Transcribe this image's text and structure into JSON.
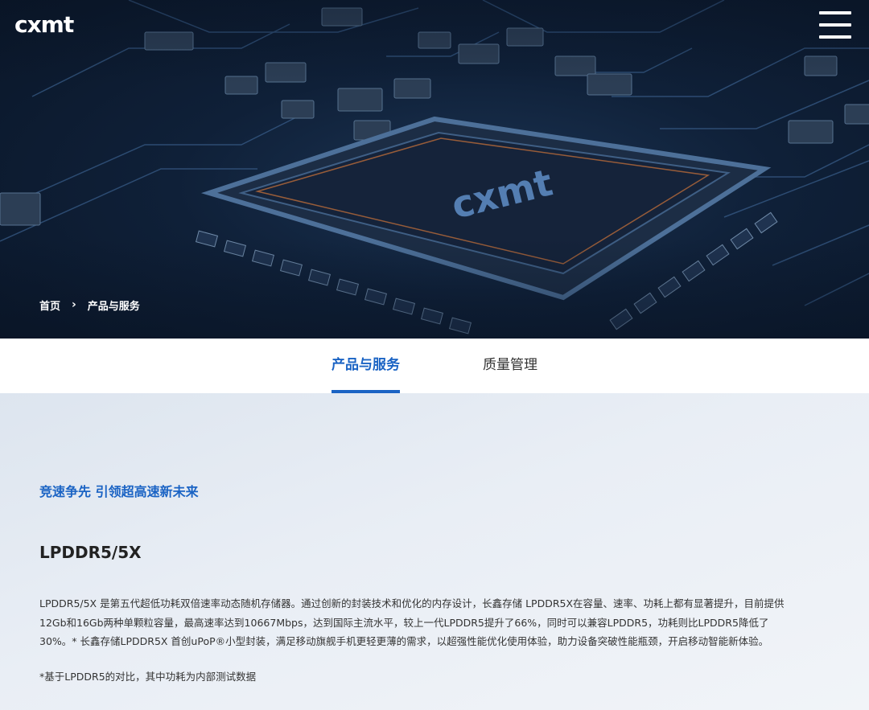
{
  "header": {
    "logo_text": "cxmt",
    "menu_icon": "hamburger-menu-icon"
  },
  "hero": {
    "chip_logo_text": "cxmt"
  },
  "breadcrumb": {
    "home": "首页",
    "separator": "›",
    "current": "产品与服务"
  },
  "tabs": [
    {
      "label": "产品与服务",
      "active": true
    },
    {
      "label": "质量管理",
      "active": false
    }
  ],
  "main": {
    "slogan": "竞速争先 引领超高速新未来",
    "product_title": "LPDDR5/5X",
    "description_lines": [
      "LPDDR5/5X 是第五代超低功耗双倍速率动态随机存储器。通过创新的封装技术和优化的内存设计，长鑫存储 LPDDR5X在容量、速率、功耗上都有显著提升，目前提供",
      "12Gb和16Gb两种单颗粒容量，最高速率达到10667Mbps，达到国际主流水平，较上一代LPDDR5提升了66%，同时可以兼容LPDDR5，功耗则比LPDDR5降低了",
      "30%。* 长鑫存储LPDDR5X 首创uPoP®小型封装，满足移动旗舰手机更轻更薄的需求，以超强性能优化使用体验，助力设备突破性能瓶颈，开启移动智能新体验。"
    ],
    "footnote": "*基于LPDDR5的对比，其中功耗为内部测试数据"
  },
  "colors": {
    "accent": "#1a63c4",
    "hero_bg": "#0f2038",
    "content_bg": "#e9eef5"
  }
}
